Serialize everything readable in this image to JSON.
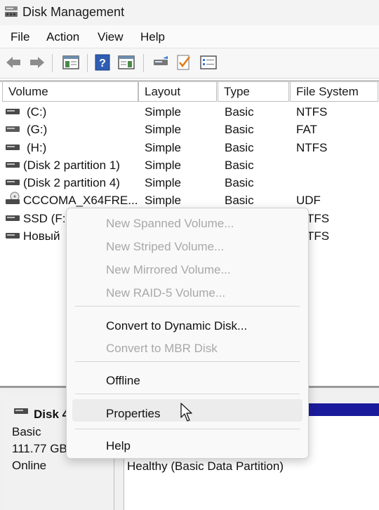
{
  "window": {
    "title": "Disk Management"
  },
  "menu": [
    "File",
    "Action",
    "View",
    "Help"
  ],
  "toolbar": [
    "back-icon",
    "forward-icon",
    "console-tree-icon",
    "help-icon",
    "show-pane-icon",
    "rescan-disks-icon",
    "check-properties-icon",
    "list-view-icon"
  ],
  "columns": [
    "Volume",
    "Layout",
    "Type",
    "File System"
  ],
  "volumes": [
    {
      "name": "(C:)",
      "layout": "Simple",
      "type": "Basic",
      "fs": "NTFS"
    },
    {
      "name": "(G:)",
      "layout": "Simple",
      "type": "Basic",
      "fs": "FAT"
    },
    {
      "name": "(H:)",
      "layout": "Simple",
      "type": "Basic",
      "fs": "NTFS"
    },
    {
      "name": "(Disk 2 partition 1)",
      "layout": "Simple",
      "type": "Basic",
      "fs": ""
    },
    {
      "name": "(Disk 2 partition 4)",
      "layout": "Simple",
      "type": "Basic",
      "fs": ""
    },
    {
      "name": "CCCOMA_X64FRE...",
      "layout": "Simple",
      "type": "Basic",
      "fs": "UDF"
    },
    {
      "name": "SSD (F:)",
      "layout": "",
      "type": "",
      "fs": "TFS"
    },
    {
      "name": "Новый",
      "layout": "",
      "type": "",
      "fs": "TFS"
    }
  ],
  "disk": {
    "name": "Disk 4",
    "type": "Basic",
    "size": "111.77 GB",
    "status": "Online",
    "partition_status": "Healthy (Basic Data Partition)"
  },
  "context_menu": {
    "new_spanned": "New Spanned Volume...",
    "new_striped": "New Striped Volume...",
    "new_mirrored": "New Mirrored Volume...",
    "new_raid5": "New RAID-5 Volume...",
    "convert_dynamic": "Convert to Dynamic Disk...",
    "convert_mbr": "Convert to MBR Disk",
    "offline": "Offline",
    "properties": "Properties",
    "help": "Help"
  },
  "colors": {
    "partition_bar": "#1a1a9c",
    "menu_highlight": "#ececec"
  }
}
